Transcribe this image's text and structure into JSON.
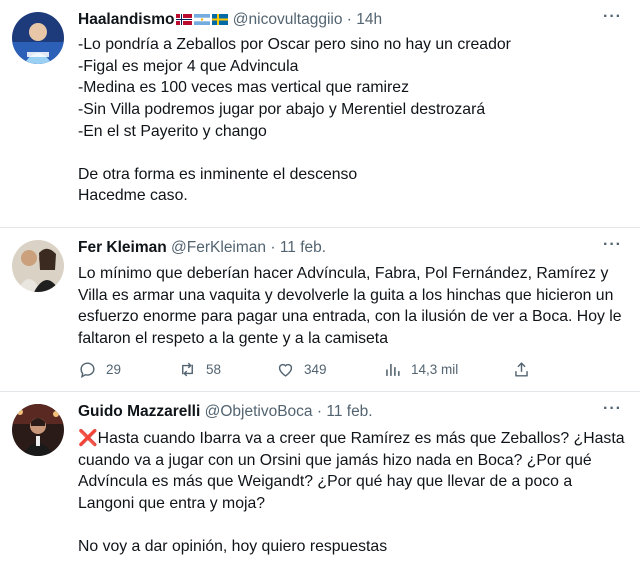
{
  "tweets": [
    {
      "name": "Haalandismo",
      "handle": "@nicovultaggiio",
      "separator": "·",
      "time": "14h",
      "lines": [
        "-Lo pondría a Zeballos por Oscar pero sino no hay un creador",
        "-Figal es mejor 4 que Advincula",
        "-Medina es 100 veces mas vertical que ramirez",
        "-Sin Villa podremos jugar por abajo y Merentiel destrozará",
        "-En el st Payerito y chango"
      ],
      "lines2": [
        "De otra forma es inminente el descenso",
        "Hacedme caso."
      ],
      "more": "···"
    },
    {
      "name": "Fer Kleiman",
      "handle": "@FerKleiman",
      "separator": "·",
      "time": "11 feb.",
      "text": "Lo mínimo que deberían hacer Advíncula, Fabra, Pol Fernández, Ramírez y Villa es armar una vaquita y devolverle la guita a los hinchas que hicieron un esfuerzo enorme para pagar una entrada, con la ilusión de ver a Boca. Hoy le faltaron el respeto a la gente y a la camiseta",
      "more": "···",
      "actions": {
        "replies": "29",
        "retweets": "58",
        "likes": "349",
        "views": "14,3 mil"
      }
    },
    {
      "name": "Guido Mazzarelli",
      "handle": "@ObjetivoBoca",
      "separator": "·",
      "time": "11 feb.",
      "x_mark": "❌",
      "text": "Hasta cuando Ibarra va a creer que Ramírez es más que Zeballos? ¿Hasta cuando va a jugar con un Orsini que jamás hizo nada en Boca? ¿Por qué Advíncula es más que Weigandt? ¿Por qué hay que llevar de a poco a Langoni que entra y moja?",
      "text2": "No voy a dar opinión, hoy quiero respuestas",
      "more": "···"
    }
  ],
  "colors": {
    "text": "#0f1419",
    "muted": "#536471",
    "divider": "#e3e7ea"
  },
  "icons": [
    "reply-icon",
    "retweet-icon",
    "like-icon",
    "views-icon",
    "share-icon"
  ]
}
